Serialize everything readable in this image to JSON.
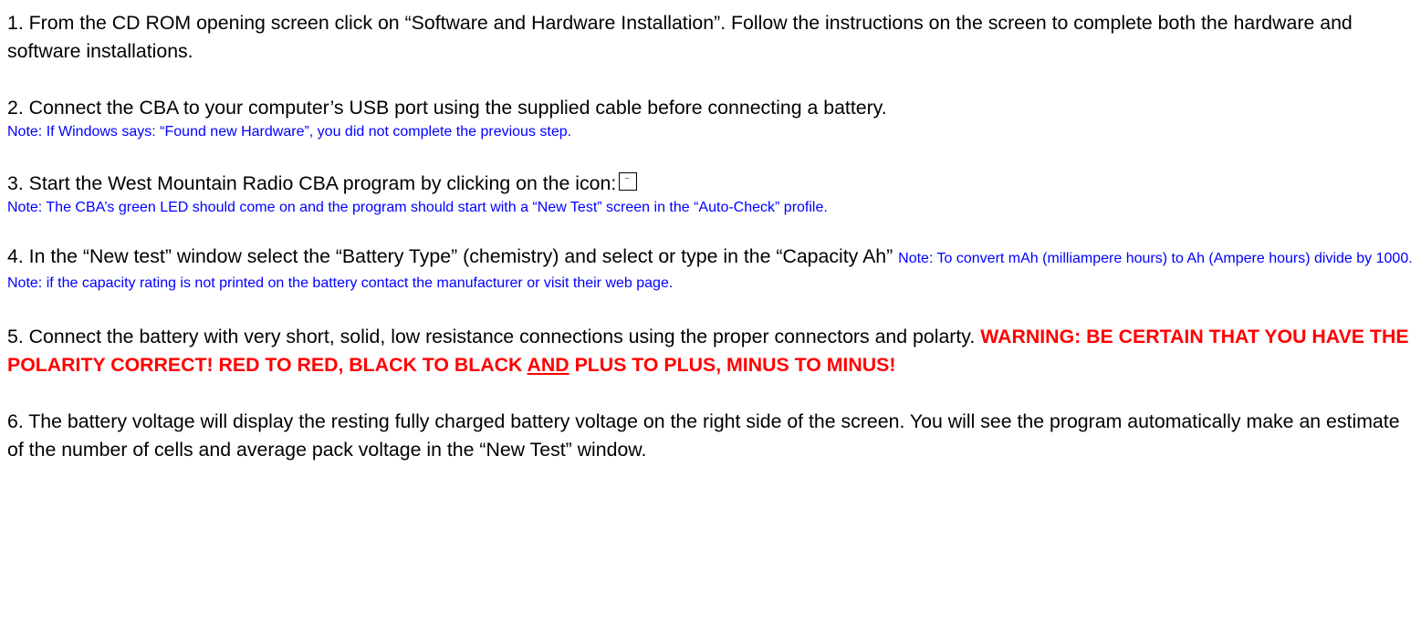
{
  "steps": [
    {
      "text": "1. From the CD ROM opening screen click on “Software and Hardware Installation”.  Follow the instructions on the screen to complete both the hardware and software installations."
    },
    {
      "text": "2. Connect the CBA to your computer’s USB port using the supplied cable before connecting a battery.",
      "note": "Note: If Windows says: “Found new Hardware”, you did not complete the previous step."
    },
    {
      "text": "3. Start the West Mountain Radio CBA program by clicking on the icon:",
      "icon": "cba-program-icon",
      "note": "Note: The CBA’s green LED should come on and the program should start  with a “New Test” screen in the “Auto-Check” profile."
    },
    {
      "text": "4. In the “New test” window select the “Battery Type” (chemistry) and select or type in the “Capacity Ah”",
      "note": "Note: To convert mAh (milliampere hours) to Ah (Ampere hours) divide by 1000. Note: if the capacity rating is not printed on the battery contact the manufacturer or visit their web page."
    },
    {
      "text": "5. Connect the battery with very short, solid, low resistance connections using the proper connectors and polarty.",
      "warning_a": "WARNING: BE CERTAIN THAT YOU HAVE THE POLARITY CORRECT! RED TO RED, BLACK TO BLACK",
      "warning_and": "AND",
      "warning_b": "PLUS TO PLUS, MINUS TO MINUS!"
    },
    {
      "text": "6.  The battery voltage will display the resting fully charged battery voltage on the right side of the screen.  You will see the program automatically make an estimate of the number of cells and average pack voltage in the “New Test” window."
    }
  ],
  "colors": {
    "text": "#000000",
    "note": "#0000ff",
    "warning": "#ff0000"
  }
}
